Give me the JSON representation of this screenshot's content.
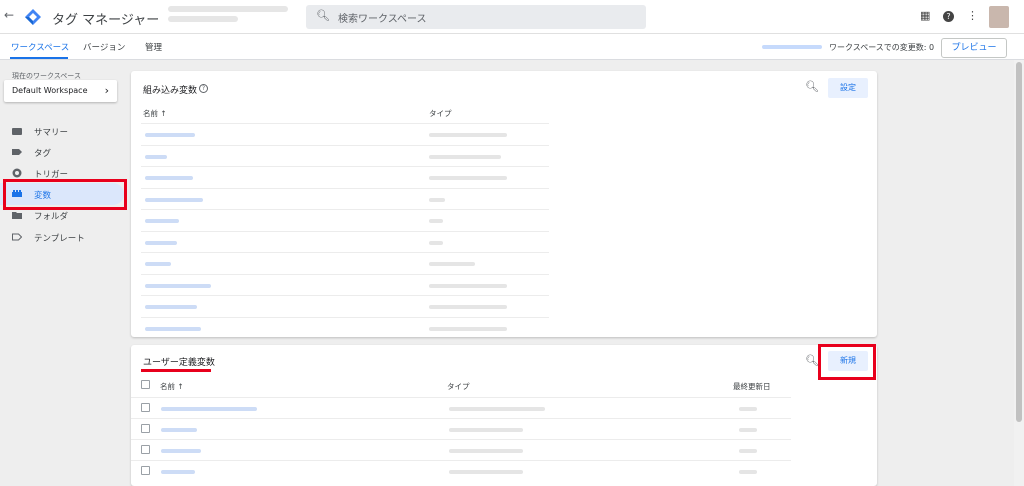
{
  "topbar": {
    "back_icon": "arrow-left-icon",
    "app_title": "タグ マネージャー",
    "search_placeholder": "検索ワークスペース",
    "icons": [
      "apps-grid-icon",
      "help-icon",
      "more-vert-icon"
    ]
  },
  "nav": {
    "tabs": [
      {
        "label": "ワークスペース",
        "active": true
      },
      {
        "label": "バージョン",
        "active": false
      },
      {
        "label": "管理",
        "active": false
      }
    ],
    "changes_label": "ワークスペースでの変更数: 0",
    "preview_label": "プレビュー"
  },
  "sidebar": {
    "workspace_label": "現在のワークスペース",
    "workspace_name": "Default Workspace",
    "items": [
      {
        "label": "サマリー",
        "icon": "summary-icon",
        "active": false
      },
      {
        "label": "タグ",
        "icon": "tag-icon",
        "active": false
      },
      {
        "label": "トリガー",
        "icon": "trigger-icon",
        "active": false
      },
      {
        "label": "変数",
        "icon": "variables-icon",
        "active": true
      },
      {
        "label": "フォルダ",
        "icon": "folder-icon",
        "active": false
      },
      {
        "label": "テンプレート",
        "icon": "template-icon",
        "active": false
      }
    ]
  },
  "builtin_card": {
    "title": "組み込み変数",
    "configure_label": "設定",
    "col_name": "名前 ↑",
    "col_type": "タイプ",
    "row_count": 10
  },
  "user_card": {
    "title": "ユーザー定義変数",
    "new_label": "新規",
    "col_name": "名前 ↑",
    "col_type": "タイプ",
    "col_updated": "最終更新日",
    "row_count": 4
  },
  "colors": {
    "accent": "#1a73e8",
    "highlight": "#e8001c",
    "active_bg": "#dbe7fb"
  }
}
